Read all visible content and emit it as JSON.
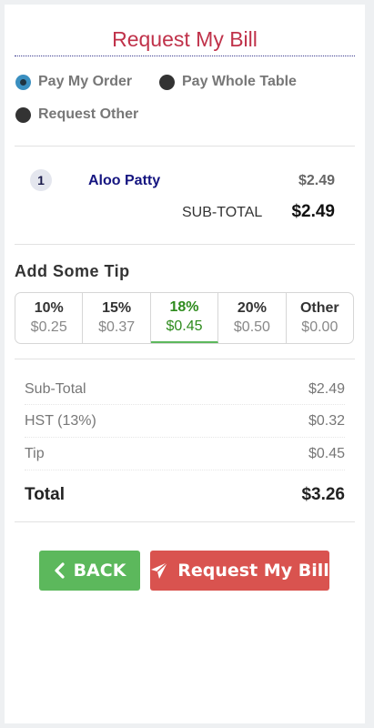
{
  "header": {
    "title": "Request My Bill"
  },
  "payment_options": [
    {
      "label": "Pay My Order",
      "selected": true
    },
    {
      "label": "Pay Whole Table",
      "selected": false
    },
    {
      "label": "Request Other",
      "selected": false
    }
  ],
  "order_items": [
    {
      "qty": "1",
      "name": "Aloo Patty",
      "price": "$2.49"
    }
  ],
  "order_subtotal": {
    "label": "SUB-TOTAL",
    "value": "$2.49"
  },
  "tip": {
    "heading": "Add Some Tip",
    "options": [
      {
        "percent": "10%",
        "amount": "$0.25"
      },
      {
        "percent": "15%",
        "amount": "$0.37"
      },
      {
        "percent": "18%",
        "amount": "$0.45"
      },
      {
        "percent": "20%",
        "amount": "$0.50"
      },
      {
        "percent": "Other",
        "amount": "$0.00"
      }
    ],
    "selected_index": 2
  },
  "summary": {
    "rows": [
      {
        "label": "Sub-Total",
        "value": "$2.49"
      },
      {
        "label": "HST (13%)",
        "value": "$0.32"
      },
      {
        "label": "Tip",
        "value": "$0.45"
      }
    ],
    "total": {
      "label": "Total",
      "value": "$3.26"
    }
  },
  "actions": {
    "back_label": "BACK",
    "request_label": "Request My Bill"
  },
  "icons": {
    "back": "chevron-left-icon",
    "request": "paper-plane-icon"
  },
  "colors": {
    "title": "#c0324a",
    "selected_radio": "#3a8fc0",
    "tip_active": "#2e8b1d",
    "back_button": "#5cb85c",
    "request_button": "#d9534f"
  }
}
